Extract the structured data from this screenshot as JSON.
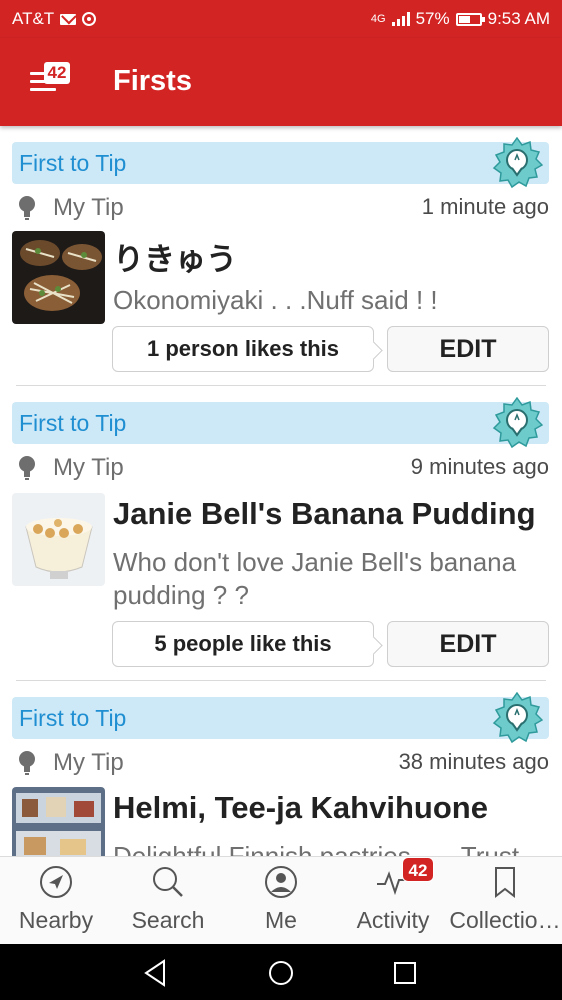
{
  "status_bar": {
    "carrier": "AT&T",
    "network": "4G",
    "battery_percent": "57%",
    "battery_level": 0.57,
    "time": "9:53 AM"
  },
  "app_bar": {
    "title": "Firsts",
    "menu_badge": "42"
  },
  "cards": [
    {
      "banner": "First to Tip",
      "meta_label": "My Tip",
      "time": "1 minute ago",
      "venue": "りきゅう",
      "tip": "Okonomiyaki . . .Nuff said ! !",
      "likes": "1 person likes this",
      "edit": "EDIT"
    },
    {
      "banner": "First to Tip",
      "meta_label": "My Tip",
      "time": "9 minutes ago",
      "venue": "Janie Bell's Banana Pudding",
      "tip": "Who don't love Janie Bell's banana pudding ? ?",
      "likes": "5 people like this",
      "edit": "EDIT"
    },
    {
      "banner": "First to Tip",
      "meta_label": "My Tip",
      "time": "38 minutes ago",
      "venue": "Helmi, Tee-ja Kahvihuone",
      "tip": "Delightful Finnish pastries . . . Trust"
    }
  ],
  "bottom_nav": {
    "items": [
      {
        "label": "Nearby",
        "icon": "compass-icon"
      },
      {
        "label": "Search",
        "icon": "search-icon"
      },
      {
        "label": "Me",
        "icon": "profile-icon"
      },
      {
        "label": "Activity",
        "icon": "activity-icon",
        "badge": "42"
      },
      {
        "label": "Collectio…",
        "icon": "bookmark-icon"
      }
    ]
  },
  "colors": {
    "brand_red": "#d32424",
    "banner_blue": "#cde8f6",
    "banner_text": "#1f8fd2",
    "badge_teal": "#6dcbcc"
  }
}
